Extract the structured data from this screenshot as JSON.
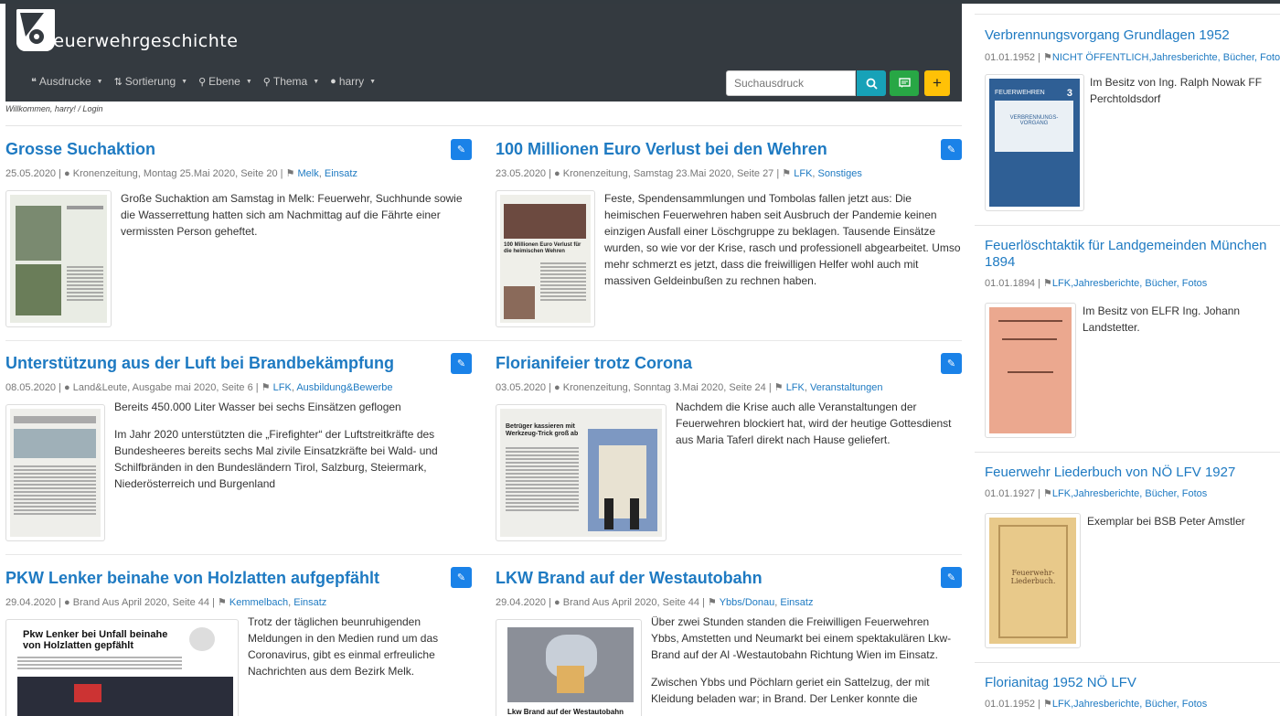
{
  "header": {
    "logo_text": "Feuerwehrgeschichte",
    "nav": [
      {
        "icon": "quote-icon",
        "label": "Ausdrucke"
      },
      {
        "icon": "sort-icon",
        "label": "Sortierung"
      },
      {
        "icon": "search-icon",
        "label": "Ebene"
      },
      {
        "icon": "search-icon",
        "label": "Thema"
      },
      {
        "icon": "user-icon",
        "label": "harry"
      }
    ],
    "search_placeholder": "Suchausdruck",
    "add_label": "+"
  },
  "welcome": "Willkommen, harry! / Login",
  "articles": [
    {
      "title": "Grosse Suchaktion",
      "date": "25.05.2020",
      "source": "Kronenzeitung, Montag 25.Mai 2020, Seite 20",
      "tags": [
        "Melk",
        "Einsatz"
      ],
      "text": [
        "Große Suchaktion am Samstag in Melk: Feuerwehr, Suchhunde sowie die Wasserrettung hatten sich am Nachmittag auf die Fährte einer vermissten Person geheftet."
      ]
    },
    {
      "title": "100 Millionen Euro Verlust bei den Wehren",
      "date": "23.05.2020",
      "source": "Kronenzeitung, Samstag 23.Mai 2020, Seite 27",
      "tags": [
        "LFK",
        "Sonstiges"
      ],
      "text": [
        "Feste, Spendensammlungen und Tombolas fallen jetzt aus: Die heimischen Feuerwehren haben seit Ausbruch der Pandemie keinen einzigen Ausfall einer Löschgruppe zu beklagen. Tausende Einsätze wurden, so wie vor der Krise, rasch und professionell abgearbeitet. Umso mehr schmerzt es jetzt, dass die freiwilligen Helfer wohl auch mit massiven Geldeinbußen zu rechnen haben."
      ]
    },
    {
      "title": "Unterstützung aus der Luft bei Brandbekämpfung",
      "date": "08.05.2020",
      "source": "Land&Leute, Ausgabe mai 2020, Seite 6",
      "tags": [
        "LFK",
        "Ausbildung&Bewerbe"
      ],
      "text": [
        "Bereits 450.000 Liter Wasser bei sechs Einsätzen geflogen",
        "Im Jahr 2020 unterstützten die „Firefighter“ der Luftstreitkräfte des Bundesheeres bereits sechs Mal zivile Einsatzkräfte bei Wald- und Schilfbränden in den Bundesländern Tirol, Salzburg, Steiermark, Niederösterreich und Burgenland"
      ]
    },
    {
      "title": "Florianifeier trotz Corona",
      "date": "03.05.2020",
      "source": "Kronenzeitung, Sonntag 3.Mai 2020, Seite 24",
      "tags": [
        "LFK",
        "Veranstaltungen"
      ],
      "text": [
        "Nachdem die Krise auch alle Veranstaltungen der Feuerwehren blockiert hat, wird der heutige Gottesdienst aus Maria Taferl direkt nach Hause geliefert."
      ]
    },
    {
      "title": "PKW Lenker beinahe von Holzlatten aufgepfählt",
      "date": "29.04.2020",
      "source": "Brand Aus April 2020, Seite 44",
      "tags": [
        "Kemmelbach",
        "Einsatz"
      ],
      "text": [
        "Trotz der täglichen beunruhigenden Meldungen in den Medien rund um das Coronavirus, gibt es einmal erfreuliche Nachrichten aus dem Bezirk Melk."
      ],
      "thumb_headline": "Pkw Lenker bei Unfall beinahe von Holzlatten gepfählt"
    },
    {
      "title": "LKW Brand auf der Westautobahn",
      "date": "29.04.2020",
      "source": "Brand Aus April 2020, Seite 44",
      "tags": [
        "Ybbs/Donau",
        "Einsatz"
      ],
      "text": [
        "Über zwei Stunden standen die Freiwilligen Feuerwehren Ybbs, Amstetten und Neumarkt bei einem spektakulären Lkw-Brand auf der Al -Westautobahn Richtung Wien im Einsatz.",
        "Zwischen Ybbs und Pöchlarn geriet ein Sattelzug, der mit Kleidung beladen war; in Brand. Der Lenker konnte die"
      ],
      "thumb_caption": "Lkw Brand auf der Westautobahn"
    }
  ],
  "thumb_headlines": {
    "a2": "100 Millionen Euro Verlust für die heimischen Wehren",
    "a4": "Betrüger kassieren mit Werkzeug-Trick groß ab"
  },
  "sidebar": [
    {
      "title": "Verbrennungsvorgang Grundlagen 1952",
      "date": "01.01.1952",
      "tags": "NICHT ÖFFENTLICH,Jahresberichte, Bücher, Fotos",
      "text": "Im Besitz von Ing. Ralph Nowak FF Perchtoldsdorf",
      "cover_line1": "FEUERWEHREN",
      "cover_num": "3",
      "cover_line2": "VERBRENNUNGS-VORGANG"
    },
    {
      "title": "Feuerlöschtaktik für Landgemeinden München 1894",
      "date": "01.01.1894",
      "tags": "LFK,Jahresberichte, Bücher, Fotos",
      "text": "Im Besitz von ELFR Ing. Johann Landstetter."
    },
    {
      "title": "Feuerwehr Liederbuch von NÖ LFV 1927",
      "date": "01.01.1927",
      "tags": "LFK,Jahresberichte, Bücher, Fotos",
      "text": "Exemplar bei BSB Peter Amstler",
      "cover_line1": "Feuerwehr-Liederbuch."
    },
    {
      "title": "Florianitag 1952 NÖ LFV",
      "date": "01.01.1952",
      "tags": "LFK,Jahresberichte, Bücher, Fotos"
    }
  ],
  "colors": {
    "header_bg": "#343a40",
    "link": "#1e7ac2",
    "edit_btn": "#1a82e8",
    "search_btn": "#17a2b8",
    "green_btn": "#28a745",
    "yellow_btn": "#ffc107"
  }
}
